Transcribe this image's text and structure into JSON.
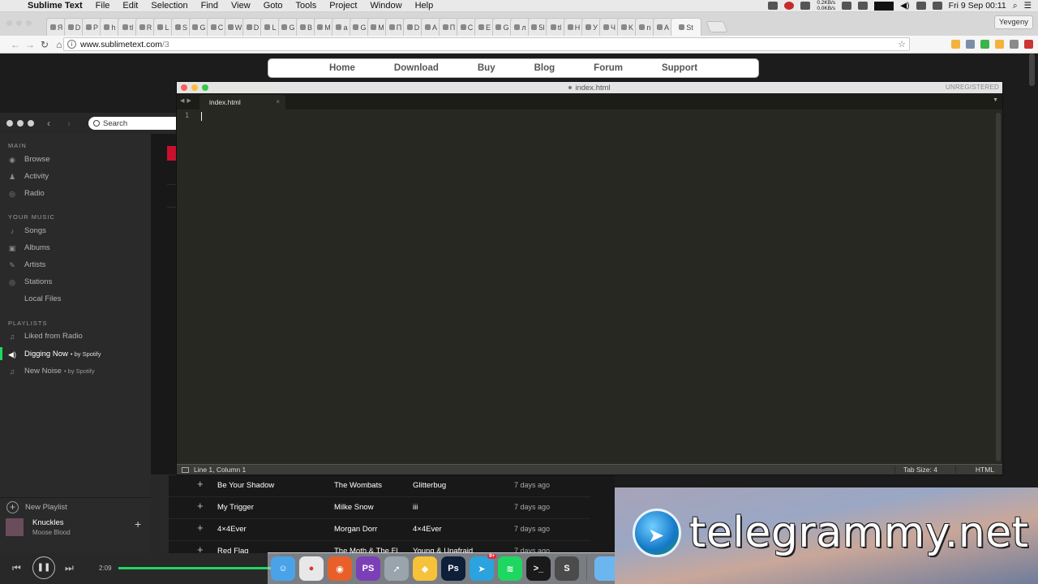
{
  "menubar": {
    "app": "Sublime Text",
    "items": [
      "File",
      "Edit",
      "Selection",
      "Find",
      "View",
      "Goto",
      "Tools",
      "Project",
      "Window",
      "Help"
    ],
    "netspeed_up": "0.2KB/s",
    "netspeed_down": "0.0KB/s",
    "clock": "Fri 9 Sep  00:11"
  },
  "browser": {
    "tabs": [
      "Я",
      "D",
      "P",
      "h",
      "tl",
      "R",
      "L",
      "S",
      "G",
      "C",
      "W",
      "D",
      "L",
      "G",
      "B",
      "M",
      "a",
      "G",
      "M",
      "П",
      "D",
      "A",
      "П",
      "C",
      "E",
      "G",
      "л",
      "5l",
      "tl",
      "H",
      "У",
      "Ч",
      "K",
      "n",
      "A",
      "St"
    ],
    "profile": "Yevgeny",
    "url_host": "www.sublimetext.com",
    "url_path": "/3",
    "ext_colors": [
      "#f3b33d",
      "#7a8fa7",
      "#3ab54a",
      "#f3b33d",
      "#8a8a8a",
      "#c33"
    ]
  },
  "site_nav": [
    "Home",
    "Download",
    "Buy",
    "Blog",
    "Forum",
    "Support"
  ],
  "editor": {
    "title": "index.html",
    "unregistered": "UNREGISTERED",
    "tab": "index.html",
    "line_number": "1",
    "status_position": "Line 1, Column 1",
    "tab_size": "Tab Size: 4",
    "syntax": "HTML"
  },
  "spotify": {
    "search_placeholder": "Search",
    "main_header": "MAIN",
    "main_items": [
      "Browse",
      "Activity",
      "Radio"
    ],
    "music_header": "YOUR MUSIC",
    "music_items": [
      "Songs",
      "Albums",
      "Artists",
      "Stations",
      "Local Files"
    ],
    "playlists_header": "PLAYLISTS",
    "playlists": [
      {
        "name": "Liked from Radio",
        "by": ""
      },
      {
        "name": "Digging Now",
        "by": "• by Spotify"
      },
      {
        "name": "New Noise",
        "by": "• by Spotify"
      }
    ],
    "new_playlist": "New Playlist",
    "now_playing": {
      "title": "Knuckles",
      "artist": "Moose Blood"
    },
    "elapsed": "2:09",
    "progress": 0.95,
    "tracks": [
      {
        "song": "Be Your Shadow",
        "artist": "The Wombats",
        "album": "Glitterbug",
        "added": "7 days ago"
      },
      {
        "song": "My Trigger",
        "artist": "Milke Snow",
        "album": "iii",
        "added": "7 days ago"
      },
      {
        "song": "4×4Ever",
        "artist": "Morgan Dorr",
        "album": "4×4Ever",
        "added": "7 days ago"
      },
      {
        "song": "Red Flag",
        "artist": "The Moth & The Fl",
        "album": "Young & Unafraid",
        "added": "7 days ago"
      }
    ]
  },
  "dock": {
    "apps": [
      {
        "name": "Finder",
        "color": "#4aa3e8",
        "glyph": "☺"
      },
      {
        "name": "Chrome",
        "color": "#e8e8e8",
        "glyph": "●"
      },
      {
        "name": "Firefox",
        "color": "#e7602a",
        "glyph": "◉"
      },
      {
        "name": "PhpStorm",
        "color": "#7b3fb8",
        "glyph": "PS"
      },
      {
        "name": "Launchpad",
        "color": "#9aa4ad",
        "glyph": "➚"
      },
      {
        "name": "Sketch",
        "color": "#f7c13a",
        "glyph": "◆"
      },
      {
        "name": "Photoshop",
        "color": "#0e1f3a",
        "glyph": "Ps"
      },
      {
        "name": "Telegram",
        "color": "#2aa3de",
        "glyph": "➤",
        "badge": "9+"
      },
      {
        "name": "Spotify",
        "color": "#1ed760",
        "glyph": "≋"
      },
      {
        "name": "Terminal",
        "color": "#1a1a1a",
        "glyph": ">_"
      },
      {
        "name": "Sublime Text",
        "color": "#4b4b4b",
        "glyph": "S"
      }
    ],
    "folders": [
      "#6cb6f0",
      "#e7e7e7",
      "#dcdcdc",
      "#e4e4e4",
      "#d8d8d8",
      "#b9bdc2"
    ]
  },
  "watermark": {
    "text": "telegrammy.net"
  }
}
